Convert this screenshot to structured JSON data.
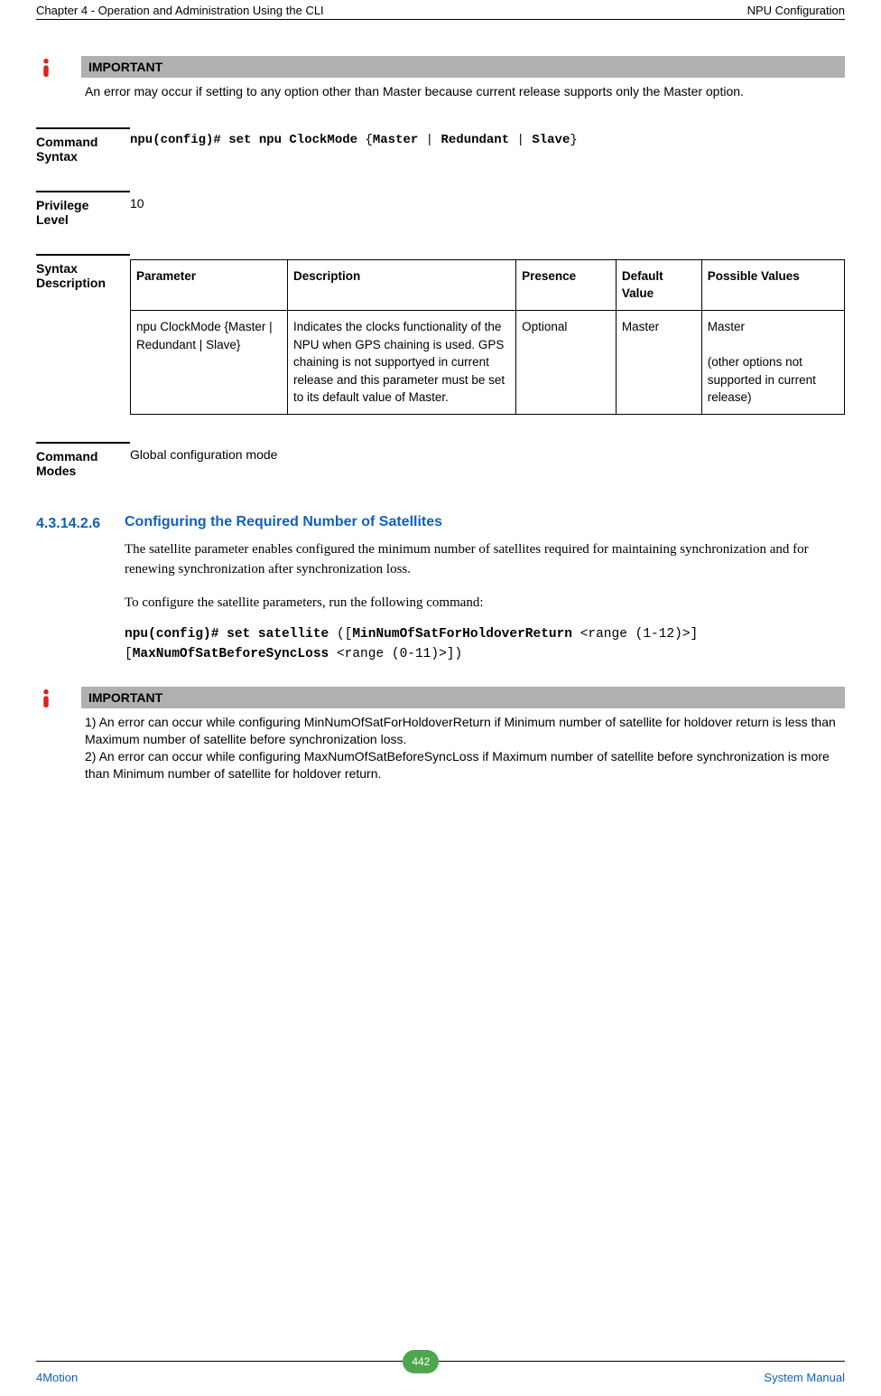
{
  "header": {
    "left": "Chapter 4 - Operation and Administration Using the CLI",
    "right": "NPU Configuration"
  },
  "callout1": {
    "title": "IMPORTANT",
    "text": "An error may occur if setting to any option other than Master because current release supports only the Master option."
  },
  "cmd_syntax": {
    "label": "Command Syntax",
    "prefix": "npu(config)# set npu ClockMode ",
    "brace_open": "{",
    "v1": "Master",
    "sep1": " | ",
    "v2": "Redundant",
    "sep2": " | ",
    "v3": "Slave",
    "brace_close": "}"
  },
  "priv_level": {
    "label": "Privilege Level",
    "value": "10"
  },
  "syntax_desc": {
    "label": "Syntax Description",
    "headers": {
      "c1": "Parameter",
      "c2": "Description",
      "c3": "Presence",
      "c4": "Default Value",
      "c5": "Possible Values"
    },
    "row": {
      "c1": "npu ClockMode {Master | Redundant | Slave}",
      "c2": "Indicates the clocks functionality of the NPU when GPS chaining is used. GPS chaining is not supportyed in current release and this parameter must be set to its default value of Master.",
      "c3": "Optional",
      "c4": "Master",
      "c5a": "Master",
      "c5b": "(other options not supported in current release)"
    }
  },
  "cmd_modes": {
    "label": "Command Modes",
    "value": "Global configuration mode"
  },
  "subsection": {
    "number": "4.3.14.2.6",
    "title": "Configuring the Required Number of Satellites",
    "p1": "The satellite parameter enables configured the minimum number of satellites required for maintaining synchronization and for renewing synchronization after synchronization loss.",
    "p2": "To configure the satellite parameters, run the following command:",
    "code_prefix": "npu(config)# set satellite ",
    "code_paren_open": "([",
    "code_k1": "MinNumOfSatForHoldoverReturn",
    "code_r1": " <range (1-12)>] [",
    "code_k2": "MaxNumOfSatBeforeSyncLoss",
    "code_r2": " <range (0-11)>])"
  },
  "callout2": {
    "title": "IMPORTANT",
    "line1": "1) An error can occur while configuring MinNumOfSatForHoldoverReturn  if Minimum number of satellite for holdover return is less than Maximum number of satellite before synchronization loss.",
    "line2": "2)  An error can occur while configuring MaxNumOfSatBeforeSyncLoss if Maximum number of satellite before synchronization is more than Minimum number of satellite for holdover return."
  },
  "footer": {
    "left": "4Motion",
    "page": "442",
    "right": "System Manual"
  }
}
